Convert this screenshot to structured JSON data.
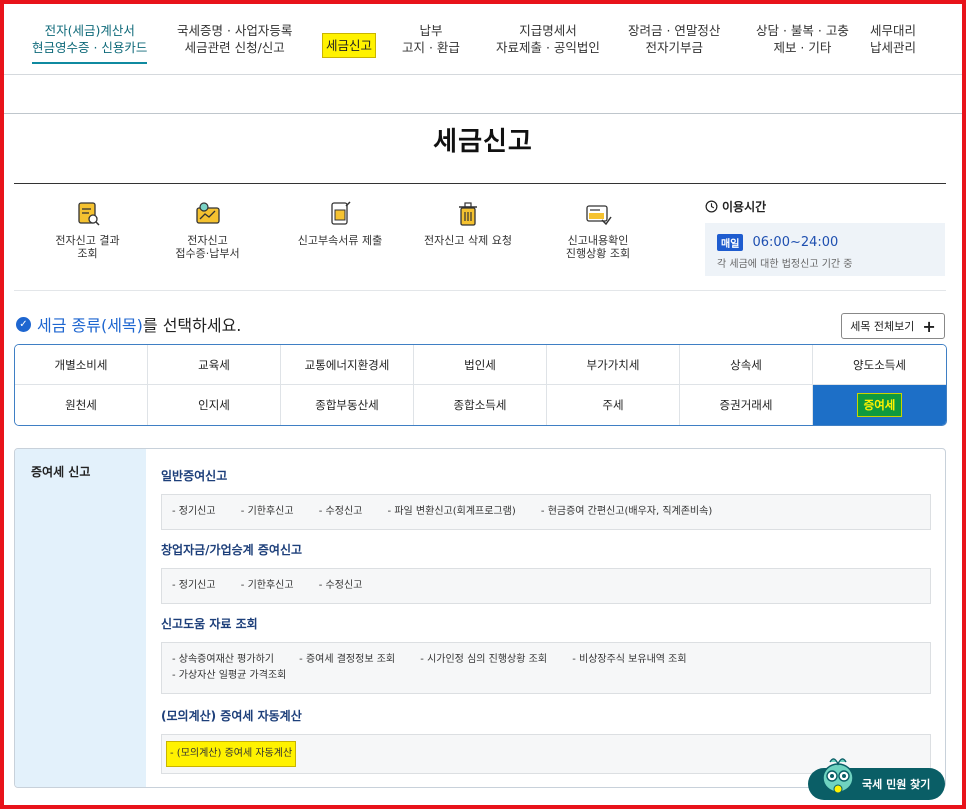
{
  "gnb": {
    "items": [
      {
        "line1": "전자(세금)계산서",
        "line2": "현금영수증 · 신용카드"
      },
      {
        "line1": "국세증명 · 사업자등록",
        "line2": "세금관련 신청/신고"
      },
      {
        "line1": "세금신고",
        "line2": ""
      },
      {
        "line1": "납부",
        "line2": "고지 · 환급"
      },
      {
        "line1": "지급명세서",
        "line2": "자료제출 · 공익법인"
      },
      {
        "line1": "장려금 · 연말정산",
        "line2": "전자기부금"
      },
      {
        "line1": "상담 · 불복 · 고충",
        "line2": "제보 · 기타"
      },
      {
        "line1": "세무대리",
        "line2": "납세관리"
      }
    ]
  },
  "page_title": "세금신고",
  "quick": {
    "items": [
      {
        "label": "전자신고 결과\n조회",
        "icon": "search-document-icon"
      },
      {
        "label": "전자신고\n접수증·납부서",
        "icon": "receipt-icon"
      },
      {
        "label": "신고부속서류 제출",
        "icon": "document-submit-icon"
      },
      {
        "label": "전자신고 삭제 요청",
        "icon": "trash-icon"
      },
      {
        "label": "신고내용확인\n진행상황 조회",
        "icon": "progress-check-icon"
      }
    ]
  },
  "hours": {
    "title": "이용시간",
    "badge": "매일",
    "time": "06:00~24:00",
    "note": "각 세금에 대한 법정신고 기간 중"
  },
  "select": {
    "heading_blue": "세금 종류(세목)",
    "heading_rest": "를 선택하세요.",
    "view_all": "세목 전체보기"
  },
  "taxes": [
    "개별소비세",
    "교육세",
    "교통에너지환경세",
    "법인세",
    "부가가치세",
    "상속세",
    "양도소득세",
    "원천세",
    "인지세",
    "종합부동산세",
    "종합소득세",
    "주세",
    "증권거래세",
    "증여세"
  ],
  "selected_tax": "증여세",
  "panel": {
    "side_title": "증여세 신고",
    "sections": [
      {
        "title": "일반증여신고",
        "links": [
          "- 정기신고",
          "- 기한후신고",
          "- 수정신고",
          "- 파일 변환신고(회계프로그램)",
          "- 현금증여 간편신고(배우자, 직계존비속)"
        ]
      },
      {
        "title": "창업자금/가업승계 증여신고",
        "links": [
          "- 정기신고",
          "- 기한후신고",
          "- 수정신고"
        ]
      },
      {
        "title": "신고도움 자료 조회",
        "links": [
          "- 상속증여재산 평가하기",
          "- 증여세 결정정보 조회",
          "- 시가인정 심의 진행상황 조회",
          "- 비상장주식 보유내역 조회",
          "- 가상자산 일평균 가격조회"
        ]
      },
      {
        "title": "(모의계산) 증여세 자동계산",
        "links": [
          "- (모의계산) 증여세 자동계산"
        ]
      }
    ]
  },
  "fab_label": "국세 민원 찾기",
  "colors": {
    "accent": "#1d6fc7",
    "highlight": "#fff200",
    "frame": "#e8131a",
    "fab": "#0a5e66"
  }
}
